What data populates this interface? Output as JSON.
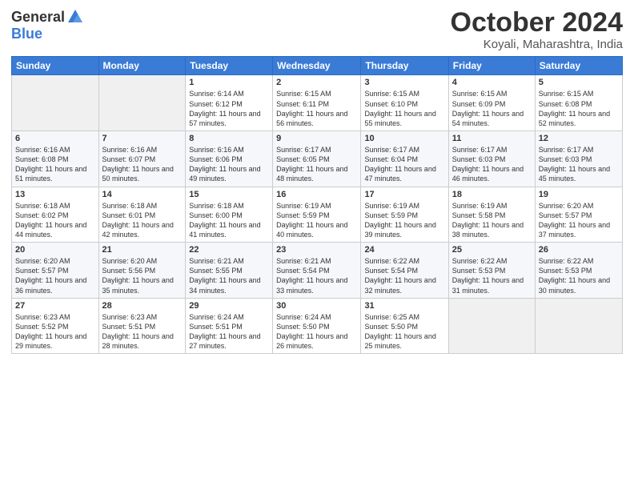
{
  "header": {
    "logo_general": "General",
    "logo_blue": "Blue",
    "title": "October 2024",
    "location": "Koyali, Maharashtra, India"
  },
  "weekdays": [
    "Sunday",
    "Monday",
    "Tuesday",
    "Wednesday",
    "Thursday",
    "Friday",
    "Saturday"
  ],
  "weeks": [
    [
      {
        "day": "",
        "info": ""
      },
      {
        "day": "",
        "info": ""
      },
      {
        "day": "1",
        "info": "Sunrise: 6:14 AM\nSunset: 6:12 PM\nDaylight: 11 hours and 57 minutes."
      },
      {
        "day": "2",
        "info": "Sunrise: 6:15 AM\nSunset: 6:11 PM\nDaylight: 11 hours and 56 minutes."
      },
      {
        "day": "3",
        "info": "Sunrise: 6:15 AM\nSunset: 6:10 PM\nDaylight: 11 hours and 55 minutes."
      },
      {
        "day": "4",
        "info": "Sunrise: 6:15 AM\nSunset: 6:09 PM\nDaylight: 11 hours and 54 minutes."
      },
      {
        "day": "5",
        "info": "Sunrise: 6:15 AM\nSunset: 6:08 PM\nDaylight: 11 hours and 52 minutes."
      }
    ],
    [
      {
        "day": "6",
        "info": "Sunrise: 6:16 AM\nSunset: 6:08 PM\nDaylight: 11 hours and 51 minutes."
      },
      {
        "day": "7",
        "info": "Sunrise: 6:16 AM\nSunset: 6:07 PM\nDaylight: 11 hours and 50 minutes."
      },
      {
        "day": "8",
        "info": "Sunrise: 6:16 AM\nSunset: 6:06 PM\nDaylight: 11 hours and 49 minutes."
      },
      {
        "day": "9",
        "info": "Sunrise: 6:17 AM\nSunset: 6:05 PM\nDaylight: 11 hours and 48 minutes."
      },
      {
        "day": "10",
        "info": "Sunrise: 6:17 AM\nSunset: 6:04 PM\nDaylight: 11 hours and 47 minutes."
      },
      {
        "day": "11",
        "info": "Sunrise: 6:17 AM\nSunset: 6:03 PM\nDaylight: 11 hours and 46 minutes."
      },
      {
        "day": "12",
        "info": "Sunrise: 6:17 AM\nSunset: 6:03 PM\nDaylight: 11 hours and 45 minutes."
      }
    ],
    [
      {
        "day": "13",
        "info": "Sunrise: 6:18 AM\nSunset: 6:02 PM\nDaylight: 11 hours and 44 minutes."
      },
      {
        "day": "14",
        "info": "Sunrise: 6:18 AM\nSunset: 6:01 PM\nDaylight: 11 hours and 42 minutes."
      },
      {
        "day": "15",
        "info": "Sunrise: 6:18 AM\nSunset: 6:00 PM\nDaylight: 11 hours and 41 minutes."
      },
      {
        "day": "16",
        "info": "Sunrise: 6:19 AM\nSunset: 5:59 PM\nDaylight: 11 hours and 40 minutes."
      },
      {
        "day": "17",
        "info": "Sunrise: 6:19 AM\nSunset: 5:59 PM\nDaylight: 11 hours and 39 minutes."
      },
      {
        "day": "18",
        "info": "Sunrise: 6:19 AM\nSunset: 5:58 PM\nDaylight: 11 hours and 38 minutes."
      },
      {
        "day": "19",
        "info": "Sunrise: 6:20 AM\nSunset: 5:57 PM\nDaylight: 11 hours and 37 minutes."
      }
    ],
    [
      {
        "day": "20",
        "info": "Sunrise: 6:20 AM\nSunset: 5:57 PM\nDaylight: 11 hours and 36 minutes."
      },
      {
        "day": "21",
        "info": "Sunrise: 6:20 AM\nSunset: 5:56 PM\nDaylight: 11 hours and 35 minutes."
      },
      {
        "day": "22",
        "info": "Sunrise: 6:21 AM\nSunset: 5:55 PM\nDaylight: 11 hours and 34 minutes."
      },
      {
        "day": "23",
        "info": "Sunrise: 6:21 AM\nSunset: 5:54 PM\nDaylight: 11 hours and 33 minutes."
      },
      {
        "day": "24",
        "info": "Sunrise: 6:22 AM\nSunset: 5:54 PM\nDaylight: 11 hours and 32 minutes."
      },
      {
        "day": "25",
        "info": "Sunrise: 6:22 AM\nSunset: 5:53 PM\nDaylight: 11 hours and 31 minutes."
      },
      {
        "day": "26",
        "info": "Sunrise: 6:22 AM\nSunset: 5:53 PM\nDaylight: 11 hours and 30 minutes."
      }
    ],
    [
      {
        "day": "27",
        "info": "Sunrise: 6:23 AM\nSunset: 5:52 PM\nDaylight: 11 hours and 29 minutes."
      },
      {
        "day": "28",
        "info": "Sunrise: 6:23 AM\nSunset: 5:51 PM\nDaylight: 11 hours and 28 minutes."
      },
      {
        "day": "29",
        "info": "Sunrise: 6:24 AM\nSunset: 5:51 PM\nDaylight: 11 hours and 27 minutes."
      },
      {
        "day": "30",
        "info": "Sunrise: 6:24 AM\nSunset: 5:50 PM\nDaylight: 11 hours and 26 minutes."
      },
      {
        "day": "31",
        "info": "Sunrise: 6:25 AM\nSunset: 5:50 PM\nDaylight: 11 hours and 25 minutes."
      },
      {
        "day": "",
        "info": ""
      },
      {
        "day": "",
        "info": ""
      }
    ]
  ]
}
